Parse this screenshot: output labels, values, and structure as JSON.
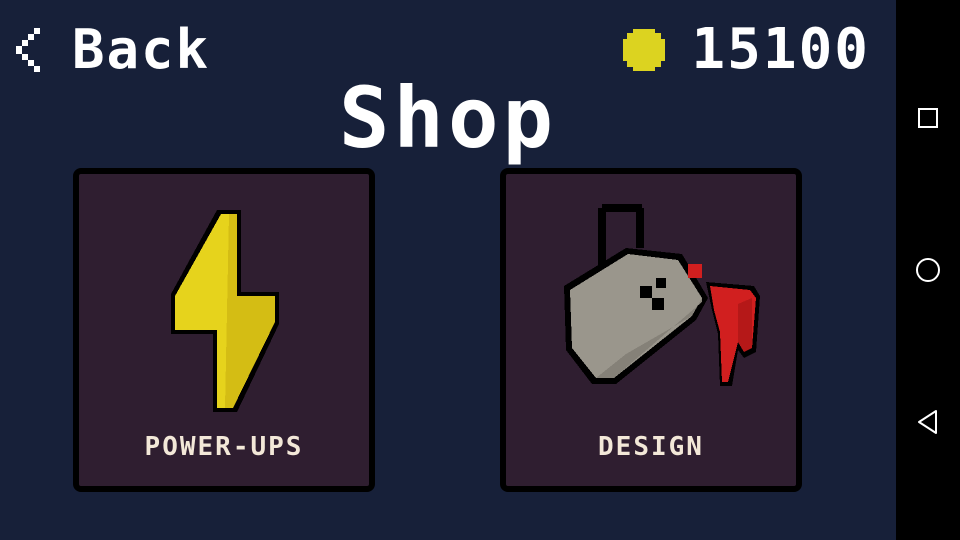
{
  "header": {
    "back_label": "Back",
    "coin_count": "15100",
    "title": "Shop"
  },
  "cards": [
    {
      "label": "POWER-UPS",
      "icon": "lightning-bolt-icon"
    },
    {
      "label": "DESIGN",
      "icon": "paint-bucket-icon"
    }
  ],
  "colors": {
    "background": "#172039",
    "card": "#2f1e30",
    "coin": "#dcd320",
    "bolt": "#e6d31c",
    "paint": "#d11f1f"
  },
  "navbar": {
    "icons": [
      "square-recents-icon",
      "circle-home-icon",
      "triangle-back-icon"
    ]
  }
}
